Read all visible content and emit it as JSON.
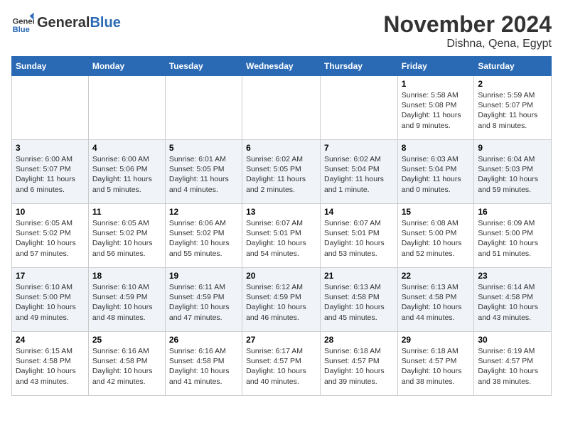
{
  "logo": {
    "general": "General",
    "blue": "Blue"
  },
  "header": {
    "month": "November 2024",
    "location": "Dishna, Qena, Egypt"
  },
  "weekdays": [
    "Sunday",
    "Monday",
    "Tuesday",
    "Wednesday",
    "Thursday",
    "Friday",
    "Saturday"
  ],
  "weeks": [
    [
      {
        "day": "",
        "info": ""
      },
      {
        "day": "",
        "info": ""
      },
      {
        "day": "",
        "info": ""
      },
      {
        "day": "",
        "info": ""
      },
      {
        "day": "",
        "info": ""
      },
      {
        "day": "1",
        "info": "Sunrise: 5:58 AM\nSunset: 5:08 PM\nDaylight: 11 hours and 9 minutes."
      },
      {
        "day": "2",
        "info": "Sunrise: 5:59 AM\nSunset: 5:07 PM\nDaylight: 11 hours and 8 minutes."
      }
    ],
    [
      {
        "day": "3",
        "info": "Sunrise: 6:00 AM\nSunset: 5:07 PM\nDaylight: 11 hours and 6 minutes."
      },
      {
        "day": "4",
        "info": "Sunrise: 6:00 AM\nSunset: 5:06 PM\nDaylight: 11 hours and 5 minutes."
      },
      {
        "day": "5",
        "info": "Sunrise: 6:01 AM\nSunset: 5:05 PM\nDaylight: 11 hours and 4 minutes."
      },
      {
        "day": "6",
        "info": "Sunrise: 6:02 AM\nSunset: 5:05 PM\nDaylight: 11 hours and 2 minutes."
      },
      {
        "day": "7",
        "info": "Sunrise: 6:02 AM\nSunset: 5:04 PM\nDaylight: 11 hours and 1 minute."
      },
      {
        "day": "8",
        "info": "Sunrise: 6:03 AM\nSunset: 5:04 PM\nDaylight: 11 hours and 0 minutes."
      },
      {
        "day": "9",
        "info": "Sunrise: 6:04 AM\nSunset: 5:03 PM\nDaylight: 10 hours and 59 minutes."
      }
    ],
    [
      {
        "day": "10",
        "info": "Sunrise: 6:05 AM\nSunset: 5:02 PM\nDaylight: 10 hours and 57 minutes."
      },
      {
        "day": "11",
        "info": "Sunrise: 6:05 AM\nSunset: 5:02 PM\nDaylight: 10 hours and 56 minutes."
      },
      {
        "day": "12",
        "info": "Sunrise: 6:06 AM\nSunset: 5:02 PM\nDaylight: 10 hours and 55 minutes."
      },
      {
        "day": "13",
        "info": "Sunrise: 6:07 AM\nSunset: 5:01 PM\nDaylight: 10 hours and 54 minutes."
      },
      {
        "day": "14",
        "info": "Sunrise: 6:07 AM\nSunset: 5:01 PM\nDaylight: 10 hours and 53 minutes."
      },
      {
        "day": "15",
        "info": "Sunrise: 6:08 AM\nSunset: 5:00 PM\nDaylight: 10 hours and 52 minutes."
      },
      {
        "day": "16",
        "info": "Sunrise: 6:09 AM\nSunset: 5:00 PM\nDaylight: 10 hours and 51 minutes."
      }
    ],
    [
      {
        "day": "17",
        "info": "Sunrise: 6:10 AM\nSunset: 5:00 PM\nDaylight: 10 hours and 49 minutes."
      },
      {
        "day": "18",
        "info": "Sunrise: 6:10 AM\nSunset: 4:59 PM\nDaylight: 10 hours and 48 minutes."
      },
      {
        "day": "19",
        "info": "Sunrise: 6:11 AM\nSunset: 4:59 PM\nDaylight: 10 hours and 47 minutes."
      },
      {
        "day": "20",
        "info": "Sunrise: 6:12 AM\nSunset: 4:59 PM\nDaylight: 10 hours and 46 minutes."
      },
      {
        "day": "21",
        "info": "Sunrise: 6:13 AM\nSunset: 4:58 PM\nDaylight: 10 hours and 45 minutes."
      },
      {
        "day": "22",
        "info": "Sunrise: 6:13 AM\nSunset: 4:58 PM\nDaylight: 10 hours and 44 minutes."
      },
      {
        "day": "23",
        "info": "Sunrise: 6:14 AM\nSunset: 4:58 PM\nDaylight: 10 hours and 43 minutes."
      }
    ],
    [
      {
        "day": "24",
        "info": "Sunrise: 6:15 AM\nSunset: 4:58 PM\nDaylight: 10 hours and 43 minutes."
      },
      {
        "day": "25",
        "info": "Sunrise: 6:16 AM\nSunset: 4:58 PM\nDaylight: 10 hours and 42 minutes."
      },
      {
        "day": "26",
        "info": "Sunrise: 6:16 AM\nSunset: 4:58 PM\nDaylight: 10 hours and 41 minutes."
      },
      {
        "day": "27",
        "info": "Sunrise: 6:17 AM\nSunset: 4:57 PM\nDaylight: 10 hours and 40 minutes."
      },
      {
        "day": "28",
        "info": "Sunrise: 6:18 AM\nSunset: 4:57 PM\nDaylight: 10 hours and 39 minutes."
      },
      {
        "day": "29",
        "info": "Sunrise: 6:18 AM\nSunset: 4:57 PM\nDaylight: 10 hours and 38 minutes."
      },
      {
        "day": "30",
        "info": "Sunrise: 6:19 AM\nSunset: 4:57 PM\nDaylight: 10 hours and 38 minutes."
      }
    ]
  ]
}
